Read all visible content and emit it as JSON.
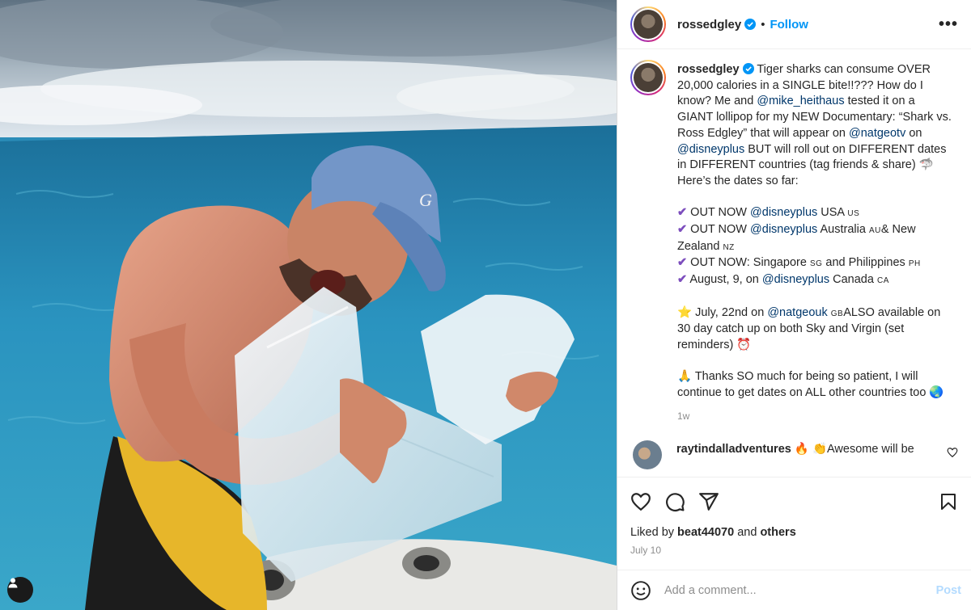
{
  "post": {
    "username": "rossedgley",
    "follow_label": "Follow",
    "more_label": "•••",
    "dot": "•"
  },
  "caption": {
    "intro": "Tiger sharks can consume OVER 20,000 calories in a SINGLE bite!!??? How do I know? Me and ",
    "mention_heithaus": "@mike_heithaus",
    "mid1": " tested it on a GIANT lollipop for my NEW Documentary: “Shark vs. Ross Edgley” that will appear on ",
    "mention_natgeotv": "@natgeotv",
    "mid2": " on ",
    "mention_disneyplus": "@disneyplus",
    "mid3": " BUT will roll out on DIFFERENT dates in DIFFERENT countries (tag friends & share) 🦈 Here’s the dates so far:",
    "line1_a": " OUT NOW ",
    "line1_b": " USA ",
    "line1_c": "US",
    "line2_a": " OUT NOW ",
    "line2_b": " Australia ",
    "line2_c": "AU",
    "line2_d": "& New Zealand ",
    "line2_e": "NZ",
    "line3_a": " OUT NOW: Singapore ",
    "line3_b": "SG",
    "line3_c": " and Philippines ",
    "line3_d": "PH",
    "line4_a": " August, 9, on ",
    "line4_b": " Canada ",
    "line4_c": "CA",
    "check": "✔",
    "star": "⭐",
    "line5_a": " July, 22nd on ",
    "mention_natgeouk": "@natgeouk",
    "line5_b": "GB",
    "line5_c": "ALSO available on 30 day catch up on both Sky and Virgin (set reminders) ⏰",
    "line6": "🙏 Thanks SO much for being so patient, I will continue to get dates on ALL other countries too 🌏",
    "time": "1w"
  },
  "comment": {
    "username": "raytindalladventures",
    "text": " 🔥 👏Awesome will be"
  },
  "footer": {
    "liked_by": "Liked by ",
    "liker": "beat44070",
    "and": " and ",
    "others": "others",
    "date": "July 10",
    "comment_placeholder": "Add a comment...",
    "post_label": "Post"
  }
}
